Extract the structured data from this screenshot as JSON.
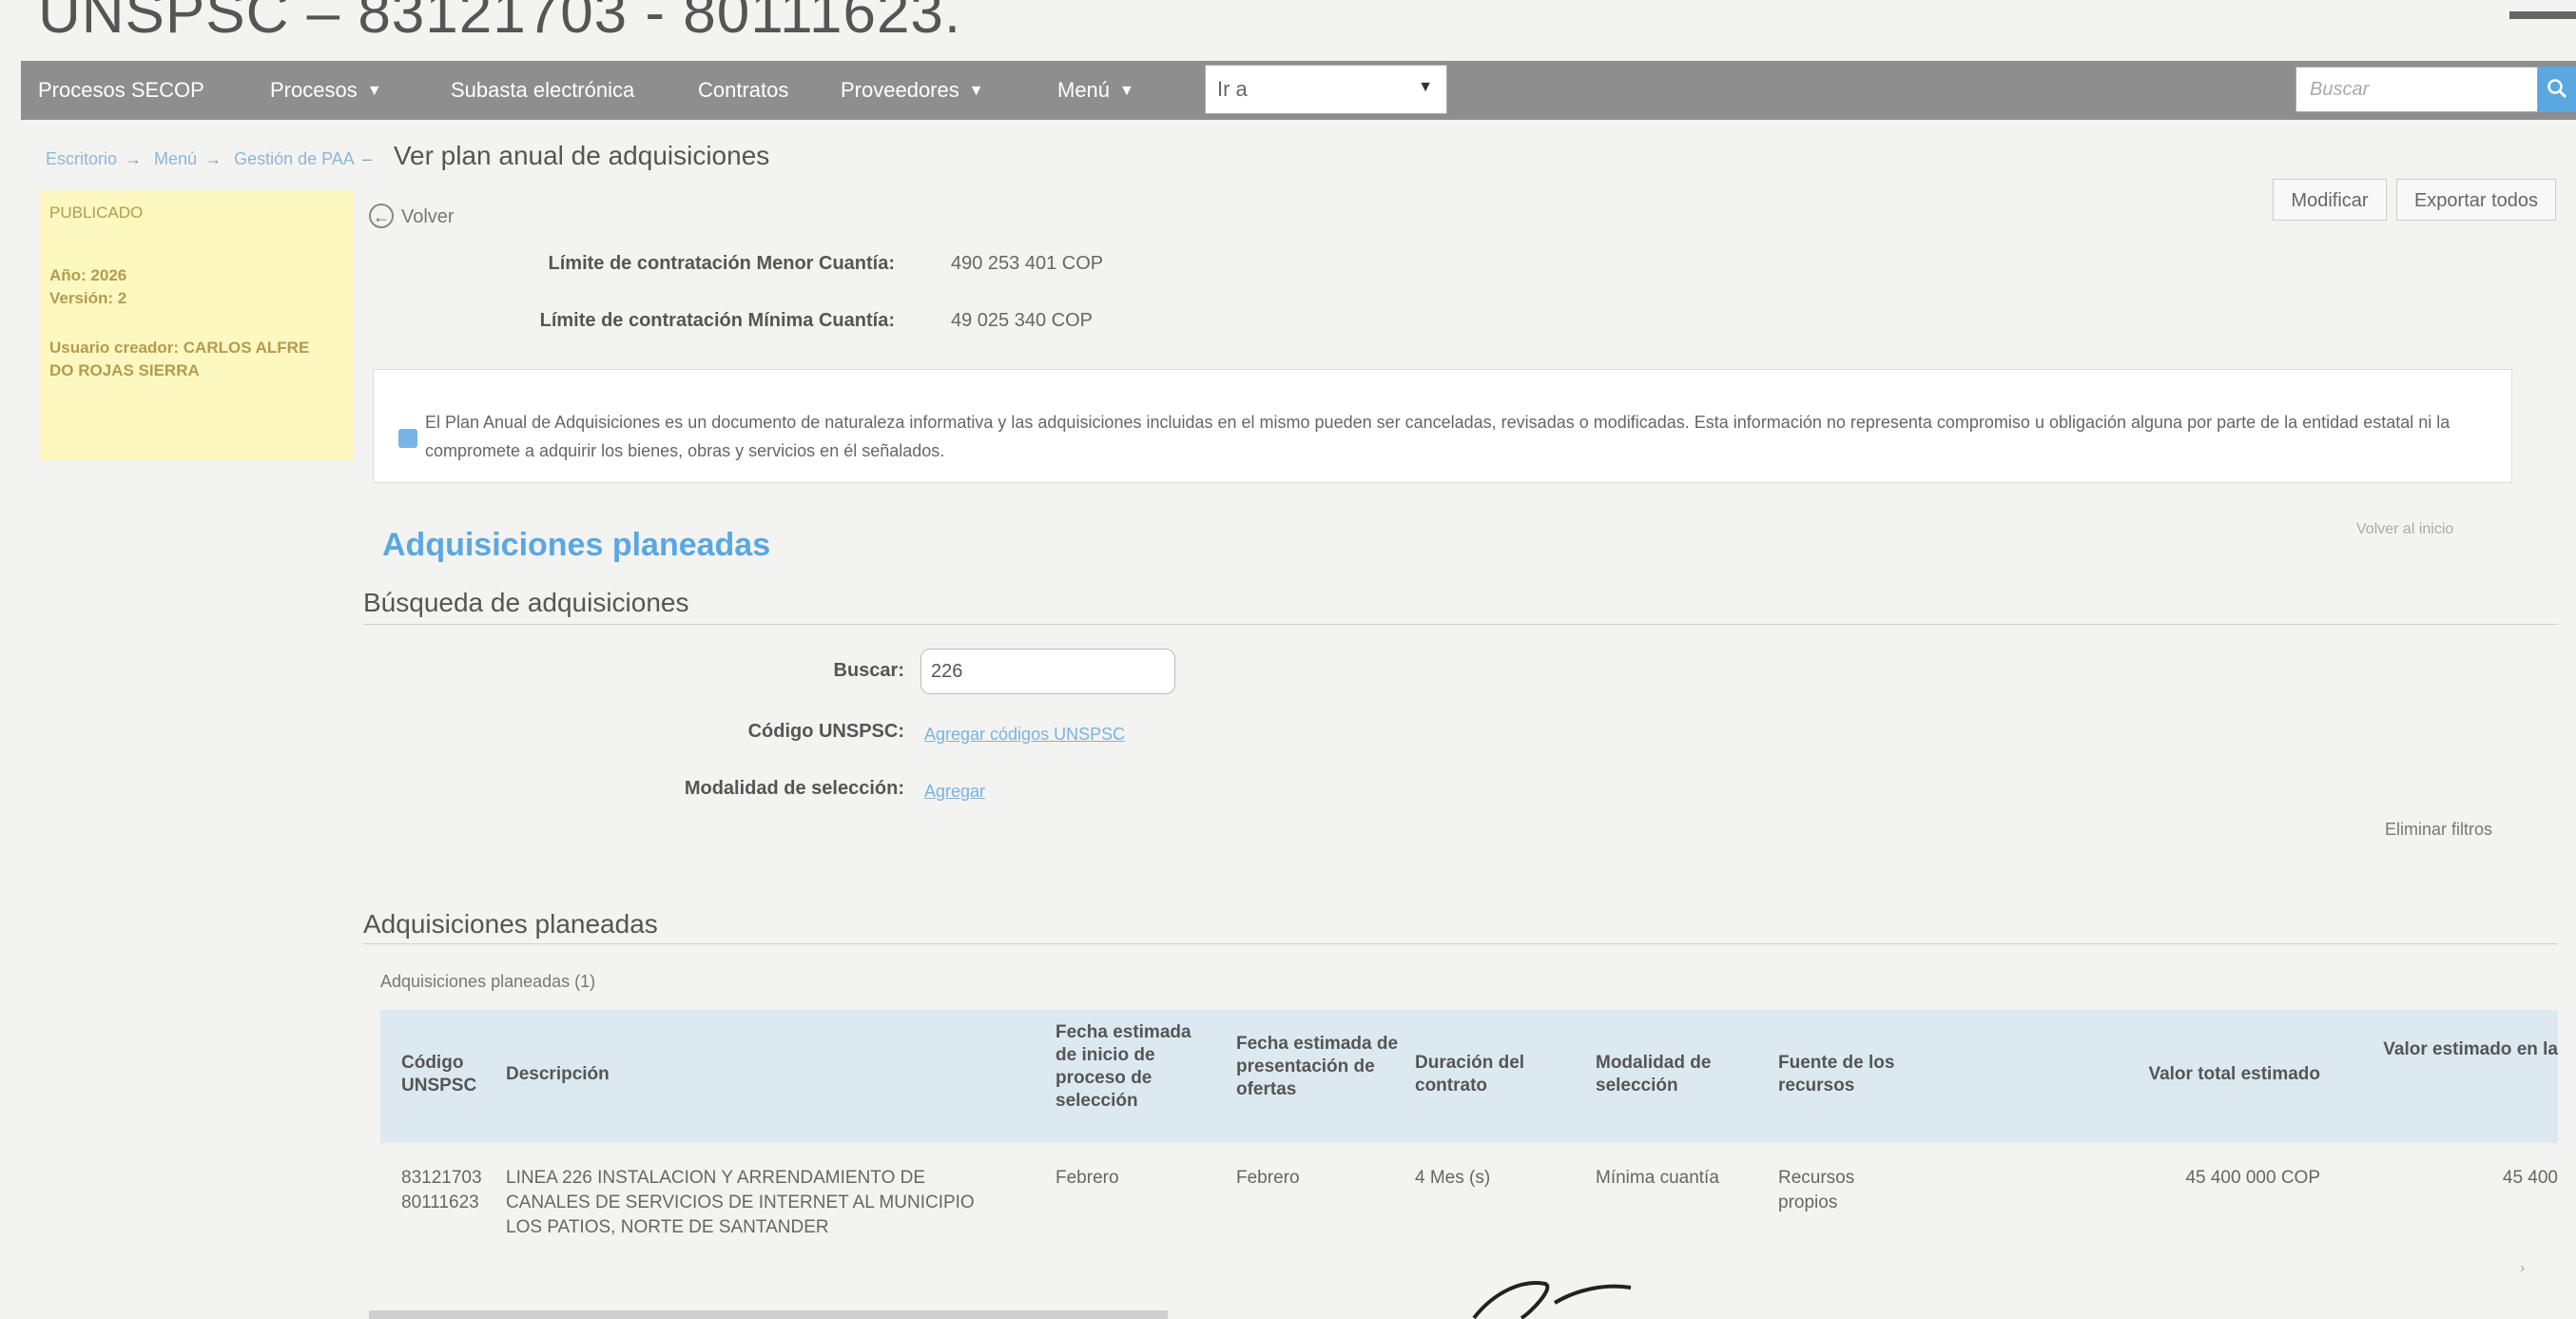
{
  "slide_title": "UNSPSC – 83121703 - 80111623.",
  "navbar": {
    "items": [
      {
        "label": "Procesos SECOP",
        "caret": false
      },
      {
        "label": "Procesos",
        "caret": true
      },
      {
        "label": "Subasta electrónica",
        "caret": false
      },
      {
        "label": "Contratos",
        "caret": false
      },
      {
        "label": "Proveedores",
        "caret": true
      },
      {
        "label": "Menú",
        "caret": true
      }
    ],
    "goto_value": "Ir a",
    "search_placeholder": "Buscar",
    "search_icon": "magnifier-icon"
  },
  "breadcrumb": {
    "items": [
      "Escritorio",
      "Menú",
      "Gestión de PAA"
    ],
    "current": "Ver plan anual de adquisiciones"
  },
  "status_panel": {
    "state": "PUBLICADO",
    "year": "Año: 2026",
    "version": "Versión: 2",
    "creator_line1": "Usuario creador: CARLOS ALFRE",
    "creator_line2": "DO ROJAS SIERRA"
  },
  "actions": {
    "back": "Volver",
    "modify": "Modificar",
    "export": "Exportar todos"
  },
  "limits": [
    {
      "label": "Límite de contratación Menor Cuantía:",
      "value": "490 253 401 COP"
    },
    {
      "label": "Límite de contratación Mínima Cuantía:",
      "value": "49 025 340 COP"
    }
  ],
  "info_text": "El Plan Anual de Adquisiciones es un documento de naturaleza informativa y las adquisiciones incluidas en el mismo pueden ser canceladas, revisadas o modificadas. Esta información no representa compromiso u obligación alguna por parte de la entidad estatal ni la compromete a adquirir los bienes, obras y servicios en él señalados.",
  "section_title": "Adquisiciones planeadas",
  "back_to_top": "Volver al inicio",
  "search_section": {
    "heading": "Búsqueda de adquisiciones",
    "search_label": "Buscar:",
    "search_value": "226",
    "unspsc_label": "Código UNSPSC:",
    "unspsc_link": "Agregar códigos UNSPSC",
    "modality_label": "Modalidad de selección:",
    "modality_link": "Agregar",
    "clear_filters": "Eliminar filtros"
  },
  "list": {
    "heading": "Adquisiciones planeadas",
    "count": "Adquisiciones planeadas (1)",
    "columns": [
      "Código UNSPSC",
      "Descripción",
      "Fecha estimada de inicio de proceso de selección",
      "Fecha estimada de presentación de ofertas",
      "Duración del contrato",
      "Modalidad de selección",
      "Fuente de los recursos",
      "Valor total estimado",
      "Valor estimado en la"
    ],
    "rows": [
      {
        "codes": [
          "83121703",
          "80111623"
        ],
        "description": [
          "LINEA 226 INSTALACION Y ARRENDAMIENTO DE",
          "CANALES DE SERVICIOS DE INTERNET AL MUNICIPIO",
          "LOS PATIOS, NORTE DE SANTANDER"
        ],
        "start": "Febrero",
        "offers": "Febrero",
        "duration": "4 Mes (s)",
        "modality": "Mínima cuantía",
        "source": [
          "Recursos",
          "propios"
        ],
        "total": "45 400 000 COP",
        "current": "45 400"
      }
    ]
  }
}
